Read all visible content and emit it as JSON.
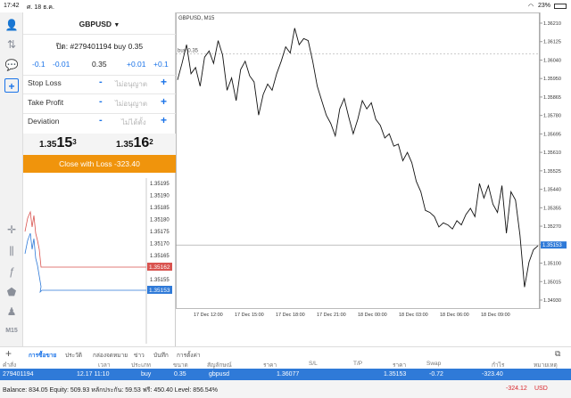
{
  "status": {
    "time": "17:42",
    "date": "ศ. 18 ธ.ค.",
    "battery": "23%"
  },
  "order": {
    "symbol": "GBPUSD",
    "ticket": "ปิด: #279401194 buy 0.35",
    "steps": [
      "-0.1",
      "-0.01",
      "0.35",
      "+0.01",
      "+0.1"
    ],
    "stop_loss_label": "Stop Loss",
    "take_profit_label": "Take Profit",
    "deviation_label": "Deviation",
    "not_set": "ไม่อนุญาต",
    "not_set_dev": "ไม่ได้ตั้ง",
    "bid": {
      "big": "1.35",
      "pips": "15",
      "frac": "3"
    },
    "ask": {
      "big": "1.35",
      "pips": "16",
      "frac": "2"
    },
    "close_label": "Close with Loss -323.40"
  },
  "mini_chart": {
    "ticks": [
      "1.35195",
      "1.35190",
      "1.35185",
      "1.35180",
      "1.35175",
      "1.35170",
      "1.35165",
      "1.35160",
      "1.35155",
      "1.35150"
    ],
    "ask_tag": "1.35162",
    "bid_tag": "1.35153"
  },
  "chart_data": {
    "type": "line",
    "title": "GBPUSD, M15",
    "order_line_label": "buy 0.35",
    "y_ticks": [
      "1.36210",
      "1.36125",
      "1.36040",
      "1.35950",
      "1.35865",
      "1.35780",
      "1.35695",
      "1.35610",
      "1.35525",
      "1.35440",
      "1.35355",
      "1.35270",
      "1.35185",
      "1.35100",
      "1.35015",
      "1.34930"
    ],
    "x_ticks": [
      "17 Dec 12:00",
      "17 Dec 15:00",
      "17 Dec 18:00",
      "17 Dec 21:00",
      "18 Dec 00:00",
      "18 Dec 03:00",
      "18 Dec 06:00",
      "18 Dec 09:00"
    ],
    "current_price_tag": "1.35153",
    "ylim": [
      1.349,
      1.3625
    ],
    "order_price": 1.36077,
    "current_price": 1.35153,
    "values": [
      1.3595,
      1.3603,
      1.3612,
      1.3598,
      1.3601,
      1.3592,
      1.3606,
      1.3609,
      1.3603,
      1.3614,
      1.3607,
      1.359,
      1.3596,
      1.3585,
      1.36,
      1.3604,
      1.3597,
      1.3594,
      1.3578,
      1.3588,
      1.3593,
      1.359,
      1.3598,
      1.3604,
      1.3611,
      1.3608,
      1.362,
      1.3612,
      1.3615,
      1.3614,
      1.3604,
      1.3592,
      1.3585,
      1.3578,
      1.3574,
      1.3568,
      1.3581,
      1.3586,
      1.3577,
      1.3569,
      1.3576,
      1.3585,
      1.3581,
      1.3584,
      1.3576,
      1.3573,
      1.3567,
      1.3569,
      1.3563,
      1.3564,
      1.3556,
      1.356,
      1.3555,
      1.3546,
      1.3541,
      1.3532,
      1.3531,
      1.3529,
      1.3524,
      1.3526,
      1.3525,
      1.3523,
      1.3527,
      1.3525,
      1.353,
      1.3533,
      1.3529,
      1.3545,
      1.3538,
      1.3544,
      1.3535,
      1.3531,
      1.3544,
      1.3521,
      1.3541,
      1.3537,
      1.352,
      1.3495,
      1.3507,
      1.3513,
      1.3515
    ]
  },
  "tabs": [
    "การซื้อขาย",
    "ประวัติ",
    "กล่องจดหมาย",
    "ข่าว",
    "บันทึก",
    "การตั้งค่า"
  ],
  "table": {
    "headers": [
      "คำสั่ง",
      "เวลา",
      "ประเภท",
      "ขนาด",
      "สัญลักษณ์",
      "ราคา",
      "S/L",
      "T/P",
      "ราคา",
      "Swap",
      "กำไร",
      "หมายเหตุ"
    ],
    "row": [
      "279401194",
      "12.17 11:10",
      "buy",
      "0.35",
      "gbpusd",
      "1.36077",
      "",
      "",
      "1.35153",
      "-0.72",
      "-323.40",
      ""
    ]
  },
  "balance": {
    "text": "Balance: 834.05 Equity: 509.93 หลักประกัน: 59.53 ฟรี: 450.40 Level: 856.54%",
    "profit": "-324.12",
    "currency": "USD"
  },
  "colors": {
    "accent": "#1a73e8",
    "close_button": "#f0940c",
    "ask_tag": "#d9534f",
    "bid_tag": "#2f7ad8",
    "loss": "#d9262c"
  }
}
